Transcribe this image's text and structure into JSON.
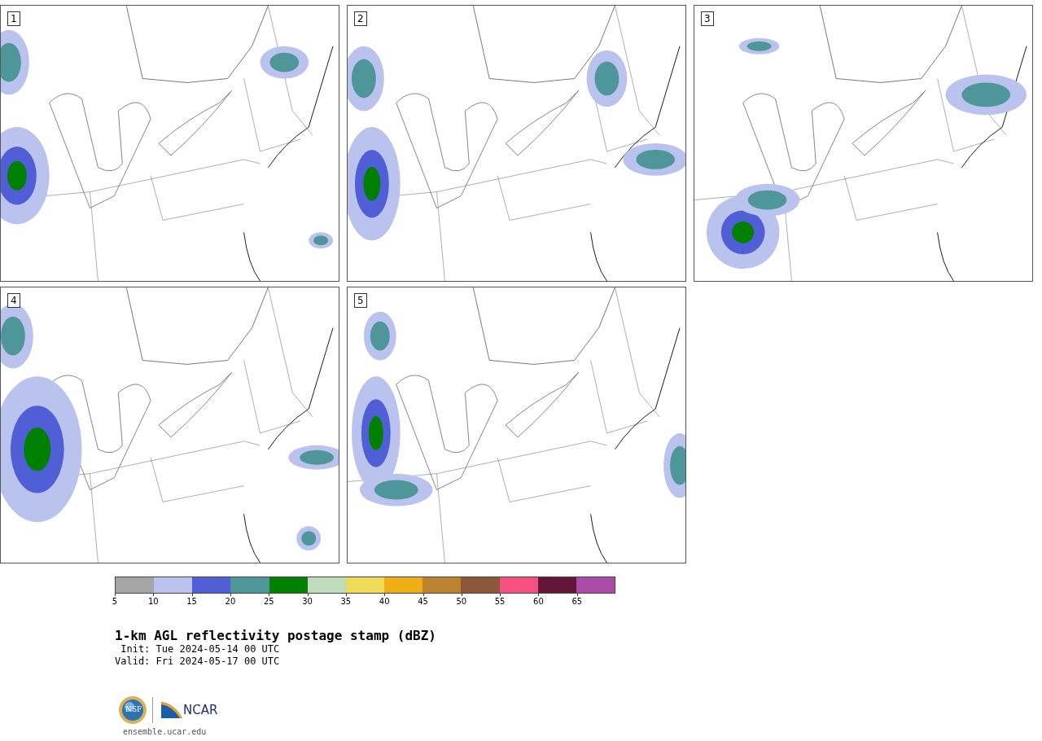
{
  "panels": [
    {
      "label": "1"
    },
    {
      "label": "2"
    },
    {
      "label": "3"
    },
    {
      "label": "4"
    },
    {
      "label": "5"
    }
  ],
  "colorbar": {
    "bins": [
      {
        "label": "5",
        "color": "#a5a5a5"
      },
      {
        "label": "10",
        "color": "#b9c3ee"
      },
      {
        "label": "15",
        "color": "#505fd6"
      },
      {
        "label": "20",
        "color": "#4f969a"
      },
      {
        "label": "25",
        "color": "#008000"
      },
      {
        "label": "30",
        "color": "#bedbbb"
      },
      {
        "label": "35",
        "color": "#eedb5a"
      },
      {
        "label": "40",
        "color": "#efad16"
      },
      {
        "label": "45",
        "color": "#bb8331"
      },
      {
        "label": "50",
        "color": "#8a5839"
      },
      {
        "label": "55",
        "color": "#f45180"
      },
      {
        "label": "60",
        "color": "#641638"
      },
      {
        "label": "65",
        "color": "#ac4ca8"
      }
    ]
  },
  "title": "1-km AGL reflectivity postage stamp (dBZ)",
  "init": " Init: Tue 2024-05-14 00 UTC",
  "valid": "Valid: Fri 2024-05-17 00 UTC",
  "logo": {
    "nsf": "NSF",
    "ncar": "NCAR"
  },
  "url": "ensemble.ucar.edu"
}
